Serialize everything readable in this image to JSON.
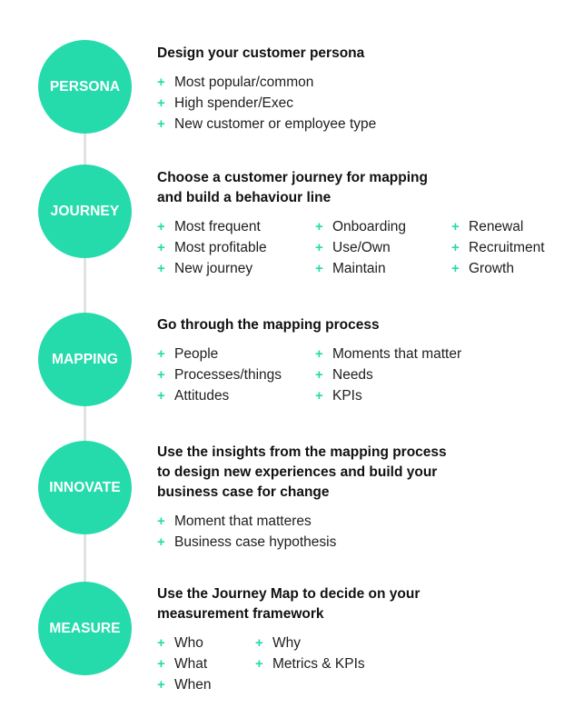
{
  "accent_color": "#25dbab",
  "stages": [
    {
      "label": "PERSONA",
      "heading": [
        "Design your customer persona"
      ],
      "columns": [
        [
          "Most popular/common",
          "High spender/Exec",
          "New customer or employee type"
        ]
      ]
    },
    {
      "label": "JOURNEY",
      "heading": [
        "Choose a customer journey for mapping",
        "and build a behaviour line"
      ],
      "columns": [
        [
          "Most frequent",
          "Most profitable",
          "New journey"
        ],
        [
          "Onboarding",
          "Use/Own",
          "Maintain"
        ],
        [
          "Renewal",
          "Recruitment",
          "Growth"
        ]
      ]
    },
    {
      "label": "MAPPING",
      "heading": [
        "Go through the mapping process"
      ],
      "columns": [
        [
          "People",
          "Processes/things",
          "Attitudes"
        ],
        [
          "Moments that matter",
          "Needs",
          "KPIs"
        ]
      ]
    },
    {
      "label": "INNOVATE",
      "heading": [
        "Use the insights from the mapping process",
        "to design new experiences and build your",
        "business case for change"
      ],
      "columns": [
        [
          "Moment that matteres",
          "Business case hypothesis"
        ]
      ]
    },
    {
      "label": "MEASURE",
      "heading": [
        "Use the Journey Map to decide on your",
        "measurement framework"
      ],
      "columns": [
        [
          "Who",
          "What",
          "When"
        ],
        [
          "Why",
          "Metrics & KPIs"
        ]
      ]
    }
  ],
  "bullet_icon": "plus-icon",
  "bullet_glyph": "+"
}
